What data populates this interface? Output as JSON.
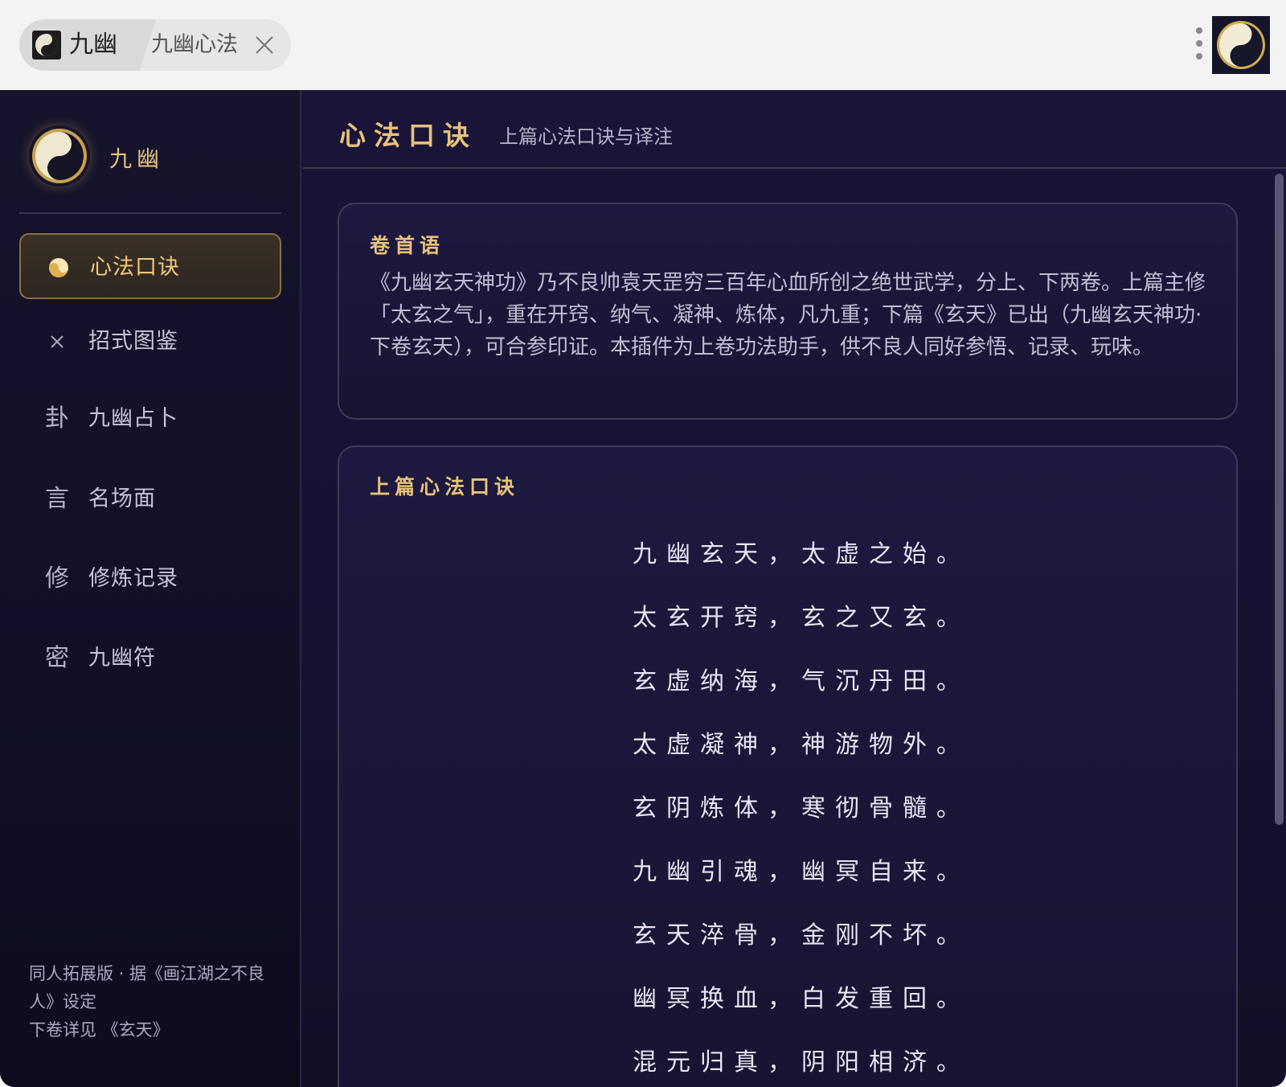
{
  "browser": {
    "tab_app_title": "九幽",
    "tab_title": "九幽心法"
  },
  "sidebar": {
    "brand_name": "九幽",
    "items": [
      {
        "label": "心法口诀",
        "icon": "◒",
        "icon_name": "yin-yang-icon",
        "active": true
      },
      {
        "label": "招式图鉴",
        "icon": "⚔",
        "icon_name": "crossed-swords-icon",
        "active": false
      },
      {
        "label": "九幽占卜",
        "icon": "卦",
        "icon_name": "divination-icon",
        "active": false
      },
      {
        "label": "名场面",
        "icon": "言",
        "icon_name": "quote-icon",
        "active": false
      },
      {
        "label": "修炼记录",
        "icon": "修",
        "icon_name": "cultivation-icon",
        "active": false
      },
      {
        "label": "九幽符",
        "icon": "密",
        "icon_name": "talisman-icon",
        "active": false
      }
    ],
    "footer_line1": "同人拓展版 · 据《画江湖之不良人》设定",
    "footer_line2": "下卷详见 《玄天》"
  },
  "main": {
    "title": "心法口诀",
    "subtitle": "上篇心法口诀与译注"
  },
  "preface": {
    "title": "卷首语",
    "body": "《九幽玄天神功》乃不良帅袁天罡穷三百年心血所创之绝世武学，分上、下两卷。上篇主修「太玄之气」，重在开窍、纳气、凝神、炼体，凡九重；下篇《玄天》已出（九幽玄天神功·下卷玄天），可合参印证。本插件为上卷功法助手，供不良人同好参悟、记录、玩味。"
  },
  "verses": {
    "title": "上篇心法口诀",
    "lines": [
      "九幽玄天，太虚之始。",
      "太玄开窍，玄之又玄。",
      "玄虚纳海，气沉丹田。",
      "太虚凝神，神游物外。",
      "玄阴炼体，寒彻骨髓。",
      "九幽引魂，幽冥自来。",
      "玄天淬骨，金刚不坏。",
      "幽冥换血，白发重回。",
      "混元归真，阴阳相济。"
    ]
  },
  "colors": {
    "accent_gold": "#e6c27a",
    "bg_dark": "#161233",
    "text_light": "#e8e4f2"
  }
}
